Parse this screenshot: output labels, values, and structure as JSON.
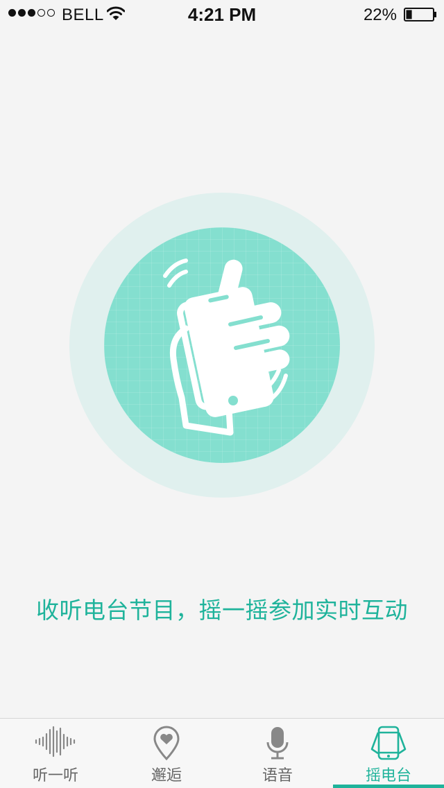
{
  "status_bar": {
    "signal_filled": 3,
    "signal_total": 5,
    "carrier": "BELL",
    "time": "4:21 PM",
    "battery_percent": "22%",
    "battery_level": 0.22,
    "icons": [
      "wifi-icon",
      "battery-icon"
    ]
  },
  "main": {
    "shake_icon": "hand-shaking-phone-icon",
    "prompt": "收听电台节目，摇一摇参加实时互动"
  },
  "tab_bar": {
    "active_index": 3,
    "tabs": [
      {
        "label": "听一听",
        "icon": "soundwave-icon"
      },
      {
        "label": "邂逅",
        "icon": "heart-pin-icon"
      },
      {
        "label": "语音",
        "icon": "microphone-icon"
      },
      {
        "label": "摇电台",
        "icon": "shake-phone-icon"
      }
    ]
  },
  "colors": {
    "accent": "#1fb39b",
    "circle_inner": "#84dfcf",
    "circle_outer": "#e0f0ee",
    "background": "#f4f4f4"
  }
}
